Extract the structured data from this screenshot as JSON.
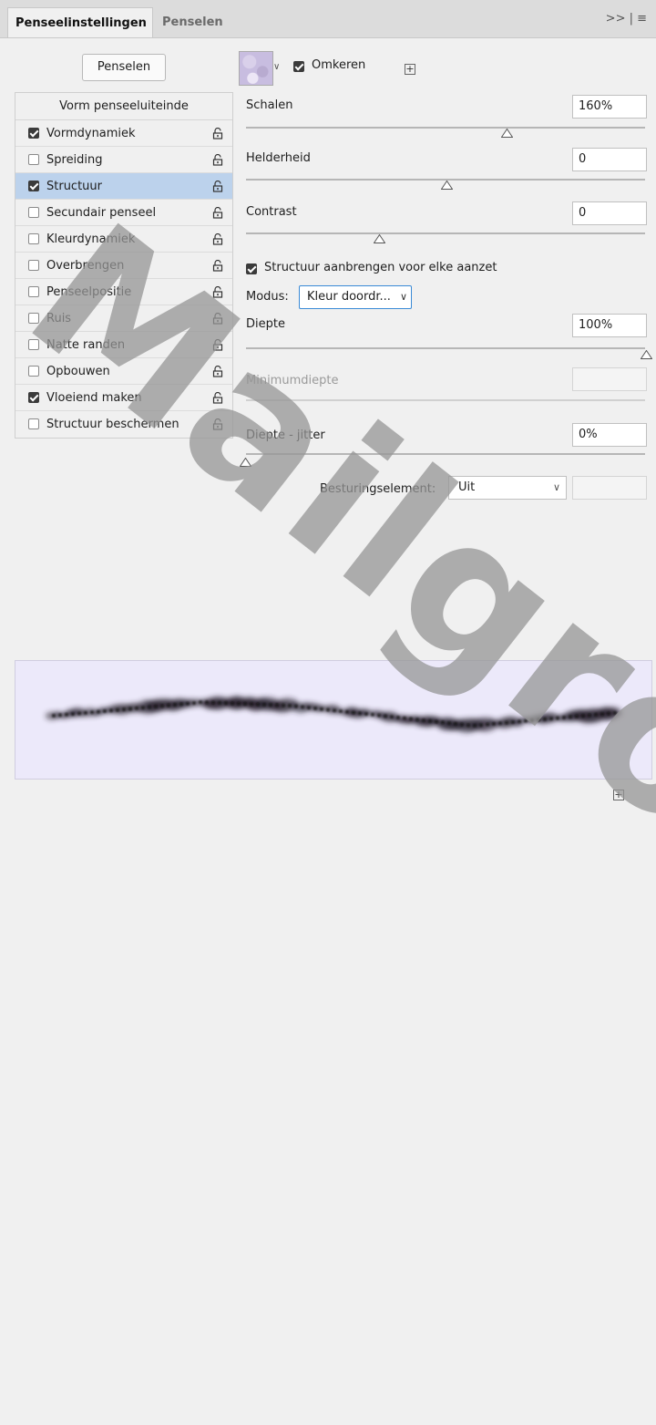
{
  "tabs": {
    "active": "Penseelinstellingen",
    "inactive": "Penselen",
    "actions": ">> | ≡"
  },
  "left": {
    "brushes_button": "Penselen",
    "list_header": "Vorm penseeluiteinde",
    "options": [
      {
        "label": "Vormdynamiek",
        "checked": true,
        "selected": false
      },
      {
        "label": "Spreiding",
        "checked": false,
        "selected": false
      },
      {
        "label": "Structuur",
        "checked": true,
        "selected": true
      },
      {
        "label": "Secundair penseel",
        "checked": false,
        "selected": false
      },
      {
        "label": "Kleurdynamiek",
        "checked": false,
        "selected": false
      },
      {
        "label": "Overbrengen",
        "checked": false,
        "selected": false
      },
      {
        "label": "Penseelpositie",
        "checked": false,
        "selected": false
      },
      {
        "label": "Ruis",
        "checked": false,
        "selected": false
      },
      {
        "label": "Natte randen",
        "checked": false,
        "selected": false
      },
      {
        "label": "Opbouwen",
        "checked": false,
        "selected": false
      },
      {
        "label": "Vloeiend maken",
        "checked": true,
        "selected": false
      },
      {
        "label": "Structuur beschermen",
        "checked": false,
        "selected": false
      }
    ]
  },
  "right": {
    "invert_label": "Omkeren",
    "invert_checked": true,
    "scale": {
      "label": "Schalen",
      "value": "160%",
      "slider": 0.65
    },
    "brightness": {
      "label": "Helderheid",
      "value": "0",
      "slider": 0.5
    },
    "contrast": {
      "label": "Contrast",
      "value": "0",
      "slider": 0.33
    },
    "texture_each_tip": {
      "label": "Structuur aanbrengen voor elke aanzet",
      "checked": true
    },
    "mode": {
      "label": "Modus:",
      "value": "Kleur doordr..."
    },
    "depth": {
      "label": "Diepte",
      "value": "100%",
      "slider": 1.0
    },
    "min_depth": {
      "label": "Minimumdiepte",
      "value": ""
    },
    "depth_jitter": {
      "label": "Diepte - jitter",
      "value": "0%",
      "slider": 0.0
    },
    "control": {
      "label": "Besturingselement:",
      "value": "Uit",
      "extra": ""
    }
  },
  "watermark": "Mailgroep Copy",
  "icons": [
    "lock-icon",
    "new-preset-icon",
    "dropdown-chevron-icon",
    "panel-menu-icon"
  ]
}
